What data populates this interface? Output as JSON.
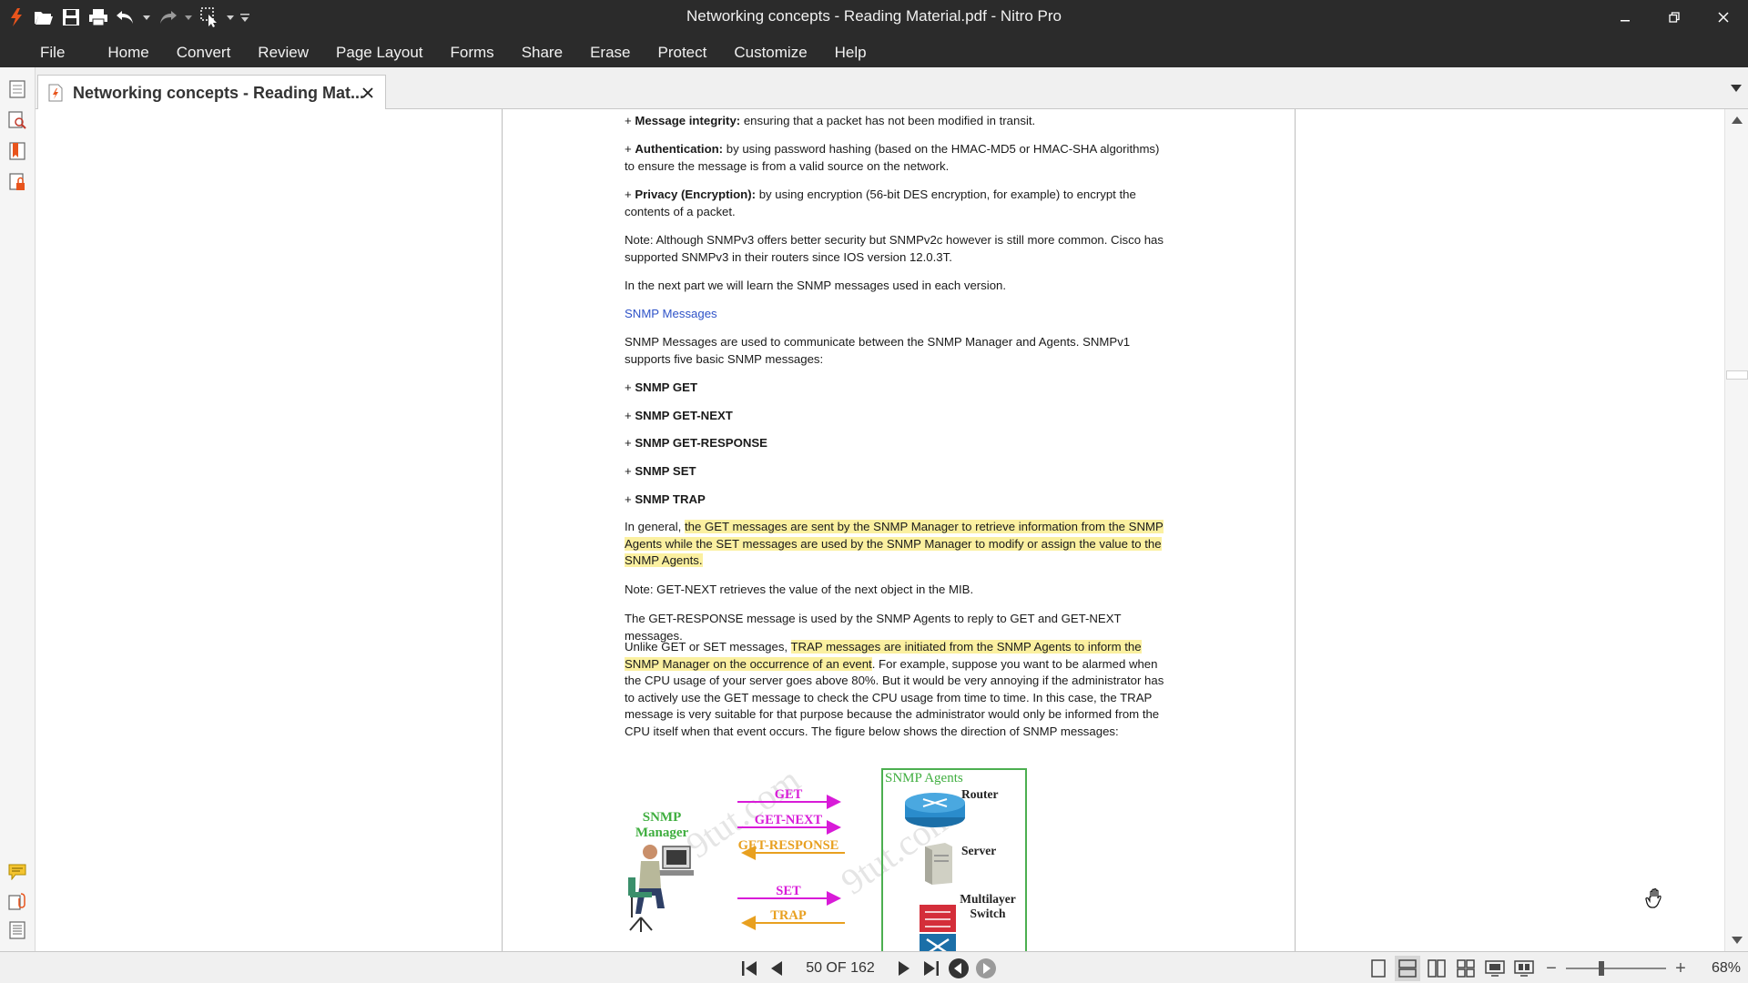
{
  "window": {
    "title": "Networking concepts - Reading Material.pdf - Nitro Pro"
  },
  "quick_access": {
    "icons": [
      "nitro-logo-icon",
      "open-folder-icon",
      "save-icon",
      "print-icon",
      "undo-icon",
      "redo-icon",
      "select-tool-icon",
      "customize-qat-icon"
    ]
  },
  "menu": {
    "items": [
      "File",
      "Home",
      "Convert",
      "Review",
      "Page Layout",
      "Forms",
      "Share",
      "Erase",
      "Protect",
      "Customize",
      "Help"
    ]
  },
  "tab": {
    "label": "Networking concepts - Reading Mat..."
  },
  "document": {
    "p1_label": "Message integrity:",
    "p1_text": " ensuring that a packet has not been modified in transit.",
    "p2_label": "Authentication:",
    "p2_text": " by using password hashing (based on the HMAC-MD5 or HMAC-SHA algorithms) to ensure the message is from a valid source on the network.",
    "p3_label": "Privacy (Encryption):",
    "p3_text": " by using encryption (56-bit DES encryption, for example) to encrypt the contents of a packet.",
    "p4": "Note: Although SNMPv3 offers better security but SNMPv2c however is still more common. Cisco has supported SNMPv3 in their routers since IOS version 12.0.3T.",
    "p5": "In the next part we will learn the SNMP messages used in each version.",
    "heading": "SNMP Messages",
    "p6": "SNMP Messages are used to communicate between the SNMP Manager and Agents. SNMPv1 supports five basic SNMP messages:",
    "msg1": "SNMP GET",
    "msg2": "SNMP GET-NEXT",
    "msg3": "SNMP GET-RESPONSE",
    "msg4": "SNMP SET",
    "msg5": "SNMP TRAP",
    "p7_a": "In general, ",
    "p7_hl": "the GET messages are sent by the SNMP Manager to retrieve information from the SNMP Agents while the SET messages are used by the SNMP Manager to modify or assign the value to the SNMP Agents.",
    "p8": "Note: GET-NEXT retrieves the value of the next object in the MIB.",
    "p9": "The GET-RESPONSE message is used by the SNMP Agents to reply to GET and GET-NEXT messages.",
    "p10_a": "Unlike GET or SET messages, ",
    "p10_hl": "TRAP messages are initiated from the SNMP Agents to inform the SNMP Manager on the occurrence of an event",
    "p10_b": ". For example, suppose you want to be alarmed when the CPU usage of your server goes above 80%. But it would be very annoying if the administrator has to actively use the GET message to check the CPU usage from time to time. In this case, the TRAP message is very suitable for that purpose because the administrator would only be informed from the CPU itself when that event occurs. The figure below shows the direction of SNMP messages:"
  },
  "diagram": {
    "manager_label": "SNMP Manager",
    "agents_title": "SNMP Agents",
    "router": "Router",
    "server": "Server",
    "switch": "Multilayer Switch",
    "arrow_get": "GET",
    "arrow_getnext": "GET-NEXT",
    "arrow_getresponse": "GET-RESPONSE",
    "arrow_set": "SET",
    "arrow_trap": "TRAP",
    "color_request": "#d81bd8",
    "color_response": "#e8a020"
  },
  "status": {
    "page_indicator": "50 OF 162",
    "zoom": "68%"
  }
}
